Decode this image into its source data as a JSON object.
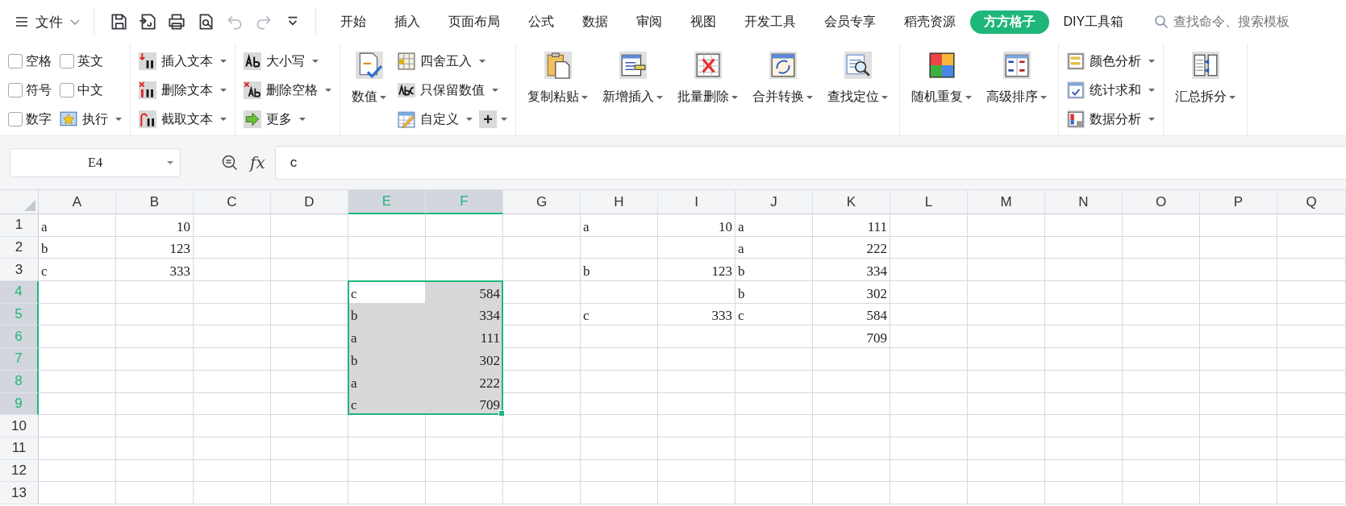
{
  "menu": {
    "label": "文件"
  },
  "quick_access": [
    {
      "disabled": false
    },
    {
      "disabled": false
    },
    {
      "disabled": false
    },
    {
      "disabled": false
    },
    {
      "disabled": true
    },
    {
      "disabled": true
    },
    {
      "disabled": false
    }
  ],
  "tabs": [
    {
      "label": "开始",
      "selected": false
    },
    {
      "label": "插入",
      "selected": false
    },
    {
      "label": "页面布局",
      "selected": false
    },
    {
      "label": "公式",
      "selected": false
    },
    {
      "label": "数据",
      "selected": false
    },
    {
      "label": "审阅",
      "selected": false
    },
    {
      "label": "视图",
      "selected": false
    },
    {
      "label": "开发工具",
      "selected": false
    },
    {
      "label": "会员专享",
      "selected": false
    },
    {
      "label": "稻壳资源",
      "selected": false
    },
    {
      "label": "方方格子",
      "selected": true
    },
    {
      "label": "DIY工具箱",
      "selected": false
    }
  ],
  "search": {
    "placeholder": "查找命令、搜索模板"
  },
  "ribbon": {
    "groups": [
      {
        "columns": [
          [
            [
              {
                "kind": "checkbox",
                "label": "空格",
                "checked": false
              }
            ],
            [
              {
                "kind": "checkbox",
                "label": "符号",
                "checked": false
              }
            ],
            [
              {
                "kind": "checkbox",
                "label": "数字",
                "checked": false
              }
            ]
          ],
          [
            [
              {
                "kind": "checkbox",
                "label": "英文",
                "checked": false
              }
            ],
            [
              {
                "kind": "checkbox",
                "label": "中文",
                "checked": false
              }
            ],
            [
              {
                "kind": "small",
                "label": "执行"
              }
            ]
          ]
        ]
      },
      {
        "columns": [
          [
            [
              {
                "kind": "small",
                "label": "插入文本"
              }
            ],
            [
              {
                "kind": "small",
                "label": "删除文本"
              }
            ],
            [
              {
                "kind": "small",
                "label": "截取文本"
              }
            ]
          ]
        ]
      },
      {
        "columns": [
          [
            [
              {
                "kind": "small",
                "label": "大小写"
              }
            ],
            [
              {
                "kind": "small",
                "label": "删除空格"
              }
            ],
            [
              {
                "kind": "small",
                "label": "更多"
              }
            ]
          ]
        ]
      },
      {
        "columns": [
          [
            [
              {
                "kind": "large",
                "label": "数值"
              }
            ]
          ],
          [
            [
              {
                "kind": "small",
                "label": "四舍五入"
              }
            ],
            [
              {
                "kind": "small",
                "label": "只保留数值"
              }
            ],
            [
              {
                "kind": "small",
                "label": "自定义"
              },
              {
                "kind": "glyph",
                "label": "+"
              }
            ]
          ]
        ]
      },
      {
        "columns": [
          [
            [
              {
                "kind": "large",
                "label": "复制粘贴"
              }
            ]
          ],
          [
            [
              {
                "kind": "large",
                "label": "新增插入"
              }
            ]
          ],
          [
            [
              {
                "kind": "large",
                "label": "批量删除"
              }
            ]
          ],
          [
            [
              {
                "kind": "large",
                "label": "合并转换"
              }
            ]
          ],
          [
            [
              {
                "kind": "large",
                "label": "查找定位"
              }
            ]
          ]
        ]
      },
      {
        "columns": [
          [
            [
              {
                "kind": "large",
                "label": "随机重复"
              }
            ]
          ],
          [
            [
              {
                "kind": "large",
                "label": "高级排序"
              }
            ]
          ]
        ]
      },
      {
        "columns": [
          [
            [
              {
                "kind": "small",
                "label": "颜色分析"
              }
            ],
            [
              {
                "kind": "small",
                "label": "统计求和"
              }
            ],
            [
              {
                "kind": "small",
                "label": "数据分析"
              }
            ]
          ]
        ]
      },
      {
        "columns": [
          [
            [
              {
                "kind": "large",
                "label": "汇总拆分"
              }
            ]
          ]
        ]
      }
    ]
  },
  "formula_bar": {
    "name_box": "E4",
    "fx_label": "fx",
    "formula": "c"
  },
  "sheet": {
    "columns": [
      {
        "label": "A",
        "selected": false
      },
      {
        "label": "B",
        "selected": false
      },
      {
        "label": "C",
        "selected": false
      },
      {
        "label": "D",
        "selected": false
      },
      {
        "label": "E",
        "selected": true
      },
      {
        "label": "F",
        "selected": true
      },
      {
        "label": "G",
        "selected": false
      },
      {
        "label": "H",
        "selected": false
      },
      {
        "label": "I",
        "selected": false
      },
      {
        "label": "J",
        "selected": false
      },
      {
        "label": "K",
        "selected": false
      },
      {
        "label": "L",
        "selected": false
      },
      {
        "label": "M",
        "selected": false
      },
      {
        "label": "N",
        "selected": false
      },
      {
        "label": "O",
        "selected": false
      },
      {
        "label": "P",
        "selected": false
      },
      {
        "label": "Q",
        "selected": false
      }
    ],
    "rows": [
      {
        "header": "1",
        "selected": false,
        "cells": [
          {
            "value": "a",
            "kind": "text"
          },
          {
            "value": "10",
            "kind": "number"
          },
          {},
          {},
          {},
          {},
          {},
          {
            "value": "a",
            "kind": "text"
          },
          {
            "value": "10",
            "kind": "number"
          },
          {
            "value": "a",
            "kind": "text"
          },
          {
            "value": "111",
            "kind": "number"
          }
        ]
      },
      {
        "header": "2",
        "selected": false,
        "cells": [
          {
            "value": "b",
            "kind": "text"
          },
          {
            "value": "123",
            "kind": "number"
          },
          {},
          {},
          {},
          {},
          {},
          {},
          {},
          {
            "value": "a",
            "kind": "text"
          },
          {
            "value": "222",
            "kind": "number"
          }
        ]
      },
      {
        "header": "3",
        "selected": false,
        "cells": [
          {
            "value": "c",
            "kind": "text"
          },
          {
            "value": "333",
            "kind": "number"
          },
          {},
          {},
          {},
          {},
          {},
          {
            "value": "b",
            "kind": "text"
          },
          {
            "value": "123",
            "kind": "number"
          },
          {
            "value": "b",
            "kind": "text"
          },
          {
            "value": "334",
            "kind": "number"
          }
        ]
      },
      {
        "header": "4",
        "selected": true,
        "cells": [
          {},
          {},
          {},
          {},
          {
            "value": "c",
            "kind": "text",
            "selected": true,
            "active": true
          },
          {
            "value": "584",
            "kind": "number",
            "selected": true,
            "active": false
          },
          {},
          {},
          {},
          {
            "value": "b",
            "kind": "text"
          },
          {
            "value": "302",
            "kind": "number"
          }
        ]
      },
      {
        "header": "5",
        "selected": true,
        "cells": [
          {},
          {},
          {},
          {},
          {
            "value": "b",
            "kind": "text",
            "selected": true,
            "active": false
          },
          {
            "value": "334",
            "kind": "number",
            "selected": true,
            "active": false
          },
          {},
          {
            "value": "c",
            "kind": "text"
          },
          {
            "value": "333",
            "kind": "number"
          },
          {
            "value": "c",
            "kind": "text"
          },
          {
            "value": "584",
            "kind": "number"
          }
        ]
      },
      {
        "header": "6",
        "selected": true,
        "cells": [
          {},
          {},
          {},
          {},
          {
            "value": "a",
            "kind": "text",
            "selected": true,
            "active": false
          },
          {
            "value": "111",
            "kind": "number",
            "selected": true,
            "active": false
          },
          {},
          {},
          {},
          {},
          {
            "value": "709",
            "kind": "number"
          }
        ]
      },
      {
        "header": "7",
        "selected": true,
        "cells": [
          {},
          {},
          {},
          {},
          {
            "value": "b",
            "kind": "text",
            "selected": true,
            "active": false
          },
          {
            "value": "302",
            "kind": "number",
            "selected": true,
            "active": false
          }
        ]
      },
      {
        "header": "8",
        "selected": true,
        "cells": [
          {},
          {},
          {},
          {},
          {
            "value": "a",
            "kind": "text",
            "selected": true,
            "active": false
          },
          {
            "value": "222",
            "kind": "number",
            "selected": true,
            "active": false
          }
        ]
      },
      {
        "header": "9",
        "selected": true,
        "cells": [
          {},
          {},
          {},
          {},
          {
            "value": "c",
            "kind": "text",
            "selected": true,
            "active": false
          },
          {
            "value": "709",
            "kind": "number",
            "selected": true,
            "active": false
          }
        ]
      },
      {
        "header": "10",
        "selected": false
      },
      {
        "header": "11",
        "selected": false
      },
      {
        "header": "12",
        "selected": false
      },
      {
        "header": "13",
        "selected": false
      }
    ]
  }
}
